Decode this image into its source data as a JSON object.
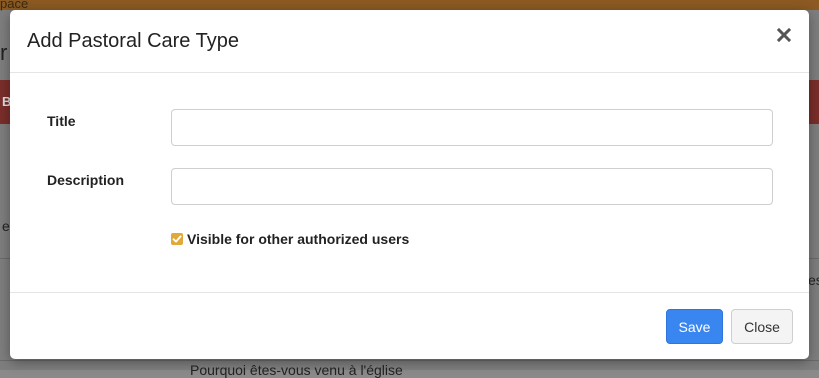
{
  "background": {
    "topbar_text": "pace",
    "redbar_text": "B",
    "side_text_left": "e",
    "side_text_right": "es",
    "bottom_text": "Pourquoi êtes-vous venu à l'église"
  },
  "modal": {
    "title": "Add Pastoral Care Type",
    "close_icon": "close-icon",
    "fields": {
      "title": {
        "label": "Title",
        "value": "",
        "placeholder": ""
      },
      "description": {
        "label": "Description",
        "value": "",
        "placeholder": ""
      }
    },
    "visible_checkbox": {
      "label": "Visible for other authorized users",
      "checked": true
    },
    "buttons": {
      "save": "Save",
      "close": "Close"
    }
  },
  "colors": {
    "accent": "#3a86f0",
    "checkbox": "#e0a93a",
    "topbar": "#8c5a22",
    "redbar": "#7a2e2b"
  }
}
